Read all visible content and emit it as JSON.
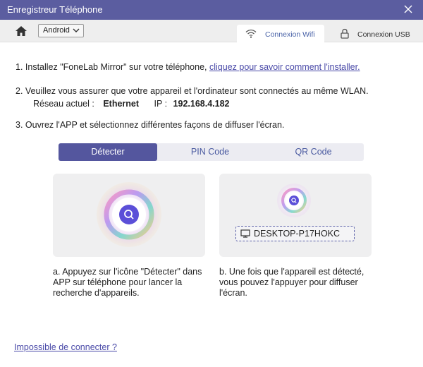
{
  "window": {
    "title": "Enregistreur Téléphone"
  },
  "toolbar": {
    "os_selected": "Android"
  },
  "tabs": {
    "wifi": "Connexion Wifi",
    "usb": "Connexion USB"
  },
  "step1": {
    "text": "1. Installez \"FoneLab Mirror\" sur votre téléphone, ",
    "link": "cliquez pour savoir comment l'installer."
  },
  "step2": {
    "text": "2. Veuillez vous assurer que votre appareil et l'ordinateur sont connectés au même WLAN.",
    "network_label": "Réseau actuel :",
    "network_value": "Ethernet",
    "ip_label": "IP :",
    "ip_value": "192.168.4.182"
  },
  "step3": {
    "text": "3. Ouvrez l'APP et sélectionnez différentes façons de diffuser l'écran."
  },
  "modes": {
    "detect": "Détecter",
    "pin": "PIN Code",
    "qr": "QR Code"
  },
  "device": {
    "name": "DESKTOP-P17HOKC"
  },
  "descriptions": {
    "a": "a. Appuyez sur l'icône \"Détecter\" dans APP sur téléphone pour lancer la recherche d'appareils.",
    "b": "b. Une fois que l'appareil est détecté, vous pouvez l'appuyer pour diffuser l'écran."
  },
  "footer": {
    "cannot_connect": "Impossible de connecter ?"
  },
  "colors": {
    "titlebar": "#5b5da0",
    "accent": "#54569e",
    "link": "#4a4aa8"
  },
  "icons": [
    "close-icon",
    "home-icon",
    "chevron-down-icon",
    "wifi-icon",
    "lock-icon",
    "search-icon",
    "monitor-icon"
  ]
}
